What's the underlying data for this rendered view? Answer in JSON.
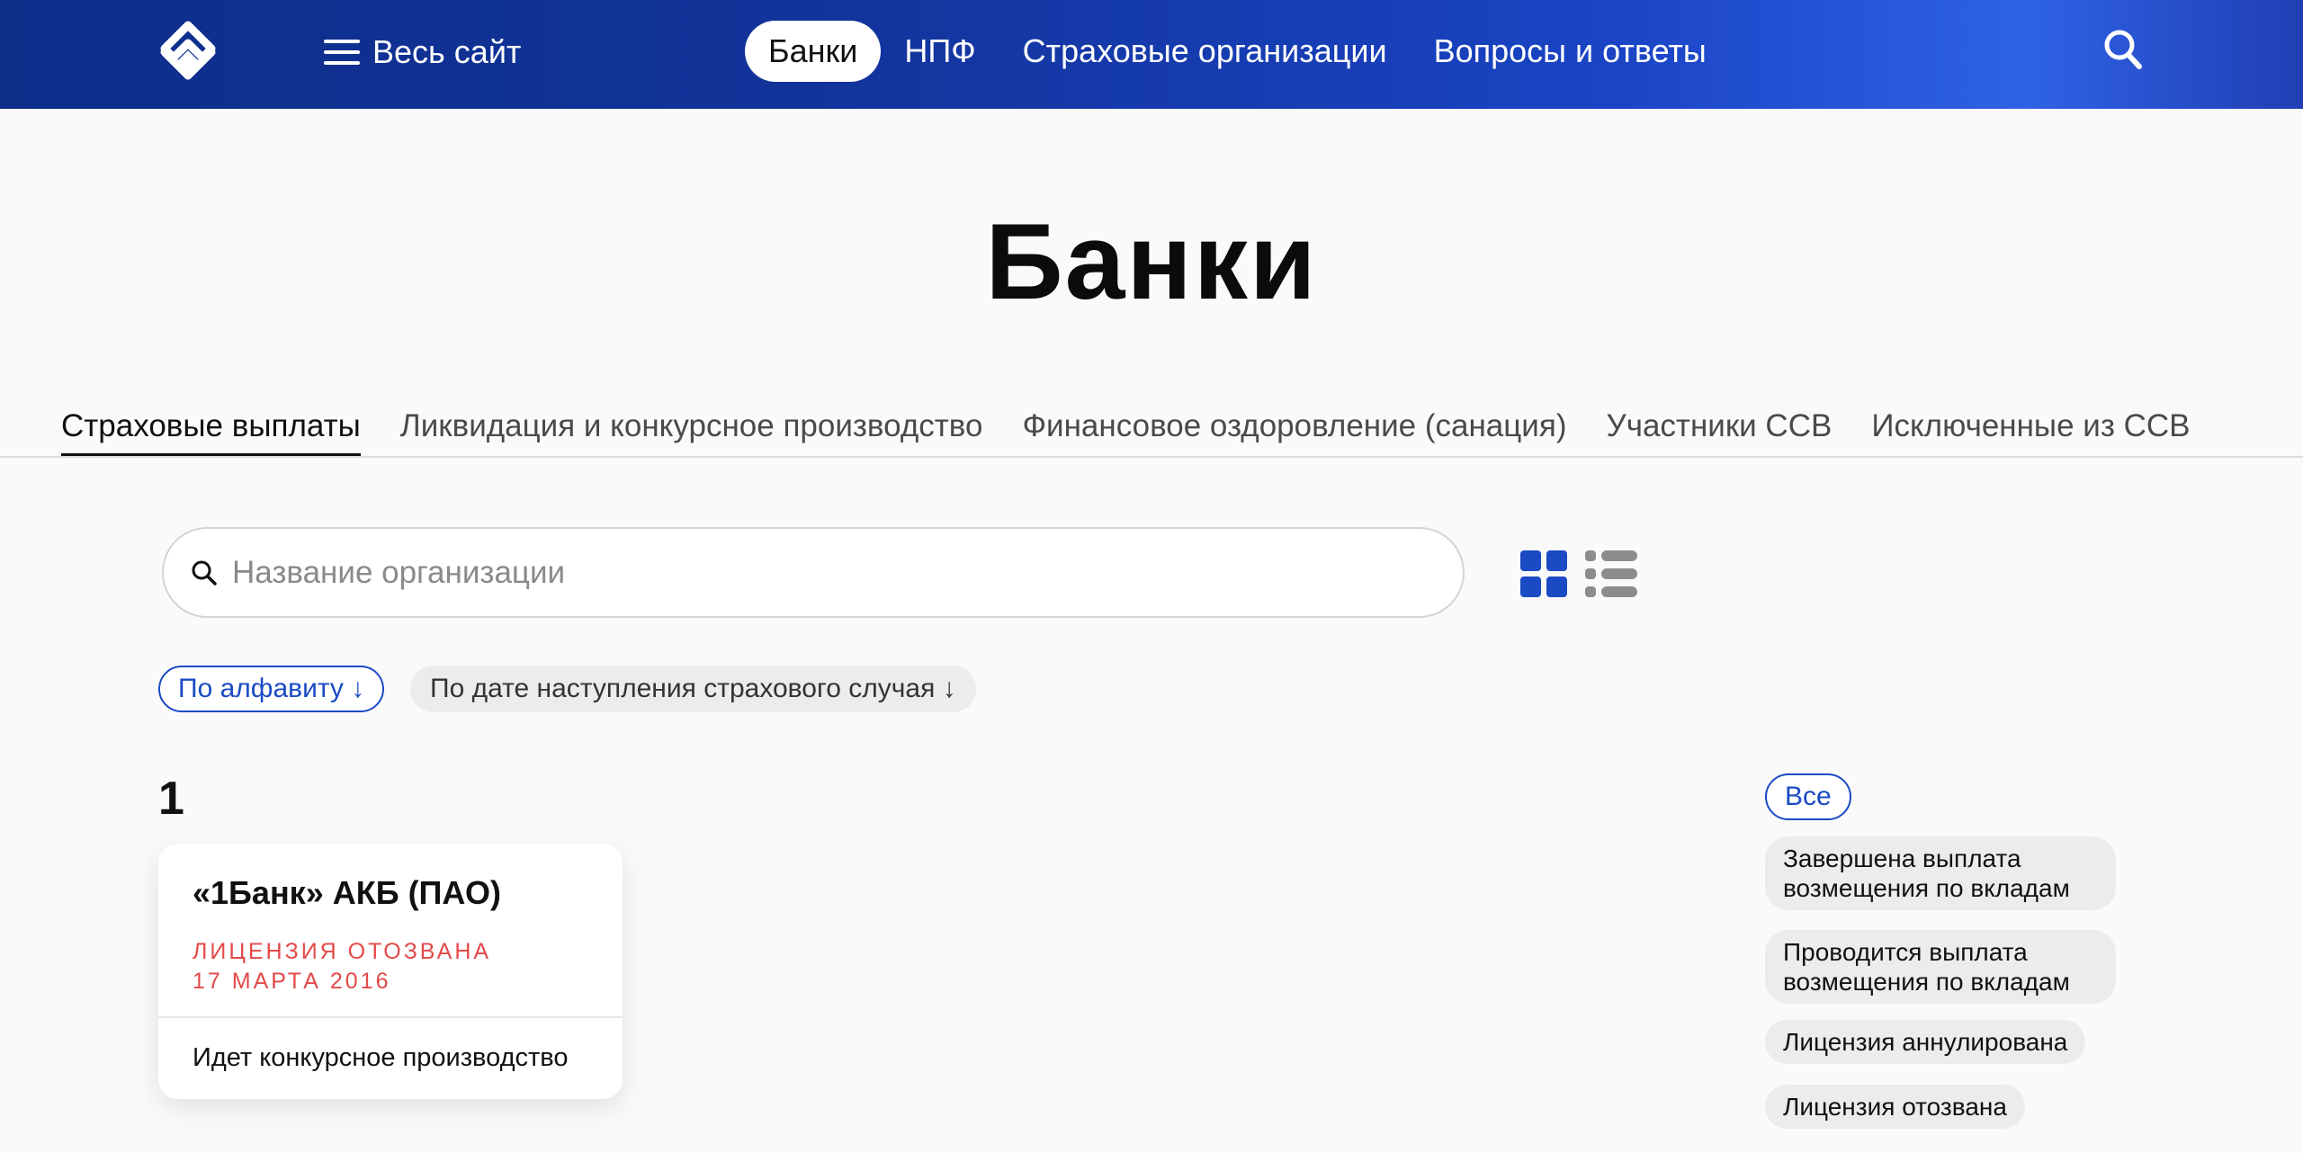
{
  "header": {
    "all_site_label": "Весь сайт",
    "nav": [
      {
        "label": "Банки",
        "active": true
      },
      {
        "label": "НПФ",
        "active": false
      },
      {
        "label": "Страховые организации",
        "active": false
      },
      {
        "label": "Вопросы и ответы",
        "active": false
      }
    ]
  },
  "page": {
    "title": "Банки"
  },
  "tabs": [
    {
      "label": "Страховые выплаты",
      "active": true
    },
    {
      "label": "Ликвидация и конкурсное производство",
      "active": false
    },
    {
      "label": "Финансовое оздоровление (санация)",
      "active": false
    },
    {
      "label": "Участники ССВ",
      "active": false
    },
    {
      "label": "Исключенные из ССВ",
      "active": false
    }
  ],
  "search": {
    "placeholder": "Название организации",
    "value": ""
  },
  "view_toggle": {
    "active": "grid"
  },
  "sort": {
    "alphabet_label": "По алфавиту ↓",
    "date_label": "По дате наступления страхового случая ↓"
  },
  "groups": [
    {
      "letter": "1",
      "cards": [
        {
          "title": "«1Банк» АКБ (ПАО)",
          "status_line1": "ЛИЦЕНЗИЯ ОТОЗВАНА",
          "status_line2": "17 МАРТА 2016",
          "footer": "Идет конкурсное производство"
        }
      ]
    }
  ],
  "filters": {
    "all_label": "Все",
    "items": [
      "Завершена выплата возмещения по вкладам",
      "Проводится выплата возмещения по вкладам",
      "Лицензия аннулирована",
      "Лицензия отозвана"
    ]
  },
  "colors": {
    "header_gradient_start": "#0e2e8a",
    "header_gradient_end": "#2f62e6",
    "accent_blue": "#1a4bc4",
    "status_red": "#e44949",
    "chip_gray": "#ececec"
  }
}
